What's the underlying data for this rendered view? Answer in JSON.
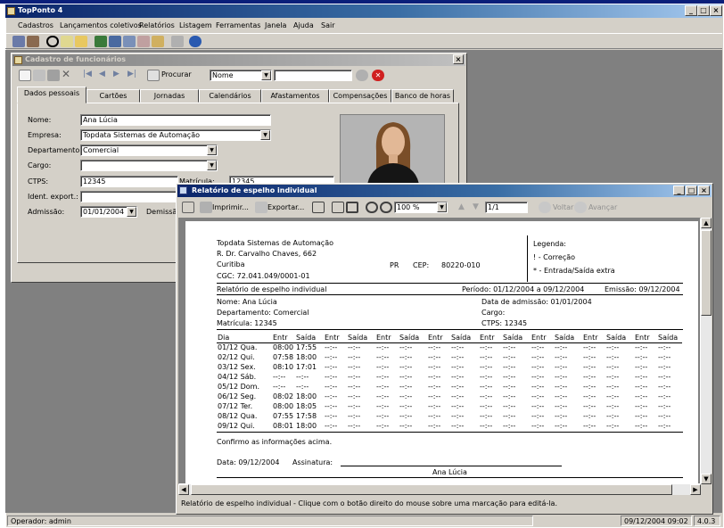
{
  "app": {
    "title": "TopPonto 4"
  },
  "menu": [
    "Cadastros",
    "Lançamentos coletivos",
    "Relatórios",
    "Listagem",
    "Ferramentas",
    "Janela",
    "Ajuda",
    "Sair"
  ],
  "window_buttons": {
    "minimize": "_",
    "restore": "□",
    "close": "×"
  },
  "employee_window": {
    "title": "Cadastro de funcionários",
    "procurar_label": "Procurar",
    "search_field_select": "Nome",
    "search_value": "",
    "tabs": [
      "Dados pessoais",
      "Cartões",
      "Jornadas",
      "Calendários",
      "Afastamentos",
      "Compensações",
      "Banco de horas"
    ],
    "active_tab": "Dados pessoais",
    "fields": {
      "nome_label": "Nome:",
      "nome": "Ana Lúcia",
      "empresa_label": "Empresa:",
      "empresa": "Topdata Sistemas de Automação",
      "departamento_label": "Departamento:",
      "departamento": "Comercial",
      "cargo_label": "Cargo:",
      "cargo": "",
      "ctps_label": "CTPS:",
      "ctps": "12345",
      "matricula_label": "Matrícula:",
      "matricula": "12345",
      "ident_label": "Ident. export.:",
      "ident": "",
      "admissao_label": "Admissão:",
      "admissao": "01/01/2004",
      "demissao_label": "Demissão"
    }
  },
  "report_window": {
    "title": "Relatório de espelho individual",
    "toolbar": {
      "print": "Imprimir...",
      "export": "Exportar...",
      "zoom": "100 %",
      "page": "1/1",
      "back": "Voltar",
      "forward": "Avançar"
    },
    "header": {
      "company": "Topdata Sistemas de Automação",
      "address": "R. Dr. Carvalho Chaves, 662",
      "city": "Curitiba",
      "cgc": "CGC:  72.041.049/0001-01",
      "state": "PR",
      "cep_label": "CEP:",
      "cep": "80220-010",
      "legend_title": "Legenda:",
      "legend_1": "! - Correção",
      "legend_2": "* - Entrada/Saída extra"
    },
    "report_name": "Relatório de espelho individual",
    "period": "Período:  01/12/2004 a 09/12/2004",
    "emission": "Emissão:  09/12/2004",
    "info": {
      "nome": "Nome:  Ana Lúcia",
      "departamento": "Departamento:   Comercial",
      "matricula": "Matrícula:  12345",
      "admissao": "Data de admissão:  01/01/2004",
      "cargo": "Cargo:",
      "ctps": "CTPS:     12345"
    },
    "columns": [
      "Dia",
      "Entr",
      "Saída",
      "Entr",
      "Saída",
      "Entr",
      "Saída",
      "Entr",
      "Saída",
      "Entr",
      "Saída",
      "Entr",
      "Saída",
      "Entr",
      "Saída",
      "Entr",
      "Saída"
    ],
    "rows": [
      {
        "dia": "01/12 Qua.",
        "e1": "08:00",
        "s1": "17:55"
      },
      {
        "dia": "02/12 Qui.",
        "e1": "07:58",
        "s1": "18:00"
      },
      {
        "dia": "03/12 Sex.",
        "e1": "08:10",
        "s1": "17:01"
      },
      {
        "dia": "04/12 Sáb.",
        "e1": "--:--",
        "s1": "--:--"
      },
      {
        "dia": "05/12 Dom.",
        "e1": "--:--",
        "s1": "--:--"
      },
      {
        "dia": "06/12 Seg.",
        "e1": "08:02",
        "s1": "18:00"
      },
      {
        "dia": "07/12 Ter.",
        "e1": "08:00",
        "s1": "18:05"
      },
      {
        "dia": "08/12 Qua.",
        "e1": "07:55",
        "s1": "17:58"
      },
      {
        "dia": "09/12 Qui.",
        "e1": "08:01",
        "s1": "18:00"
      }
    ],
    "empty_cell": "--:--",
    "confirm": "Confirmo as informações acima.",
    "data_line": "Data:  09/12/2004",
    "signature_label": "Assinatura:",
    "signature_name": "Ana Lúcia",
    "status": "Relatório de espelho individual - Clique com o botão direito do mouse sobre uma marcação para editá-la."
  },
  "statusbar": {
    "operator": "Operador: admin",
    "datetime": "09/12/2004  09:02",
    "version": "4.0.3"
  }
}
